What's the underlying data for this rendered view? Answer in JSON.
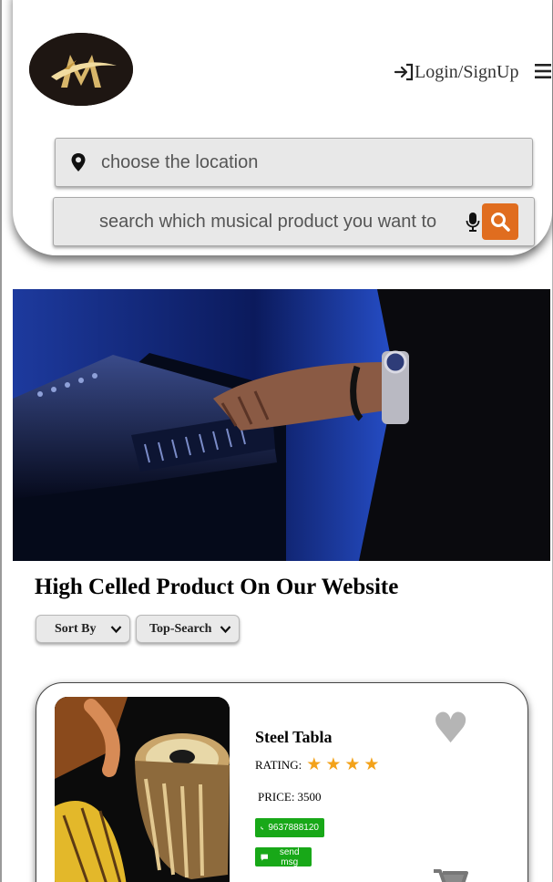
{
  "header": {
    "logo_letter": "M",
    "login_label": "Login/SignUp",
    "login_icon": "sign-in-icon",
    "menu_icon": "hamburger-menu-icon"
  },
  "search": {
    "location_placeholder": "choose the location",
    "location_icon": "map-pin-icon",
    "product_placeholder": "search which musical product you want to",
    "mic_icon": "microphone-icon",
    "search_icon": "search-icon",
    "accent_color": "#e06d1f"
  },
  "hero": {
    "image_description": "hands playing a keyboard synthesizer under blue light"
  },
  "section": {
    "title": "High Celled Product On Our Website",
    "sort_label": "Sort By",
    "filter_label": "Top-Search"
  },
  "product": {
    "name": "Steel Tabla",
    "rating_label": "RATING:",
    "rating_stars": 4,
    "price_label": "PRICE:",
    "price_value": "3500",
    "phone": "9637888120",
    "message_label": "send msg",
    "status_color": "#18a818",
    "star_color": "#f3a21a"
  }
}
